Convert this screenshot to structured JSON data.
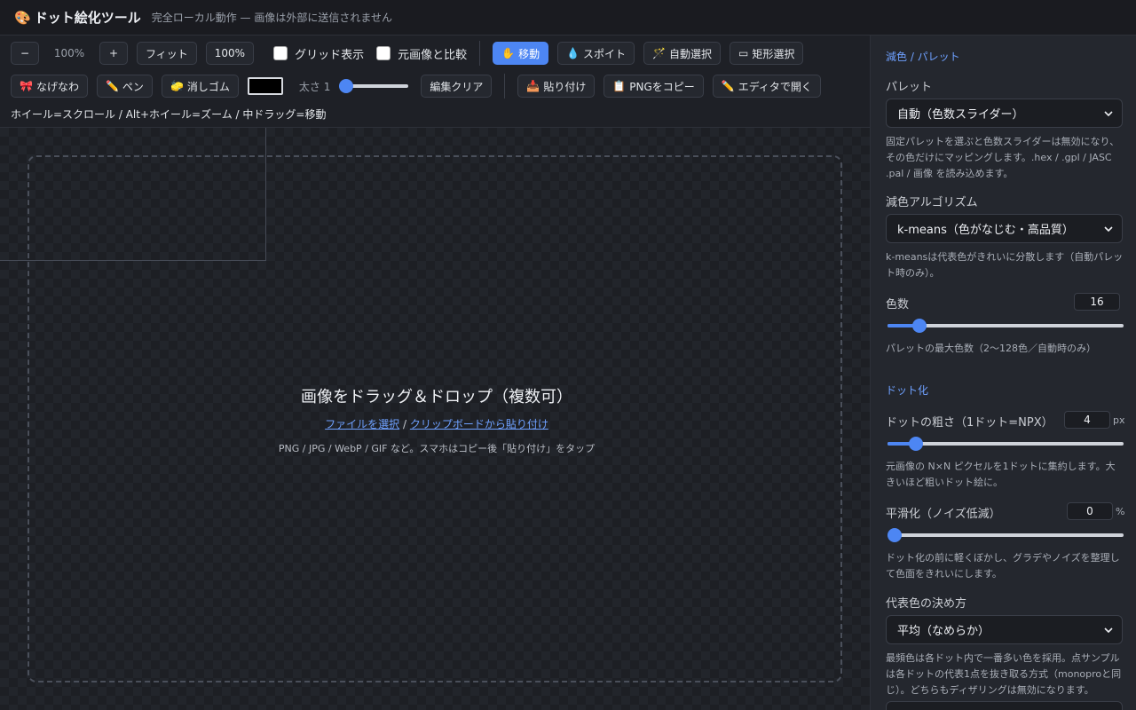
{
  "header": {
    "logo_icon": "palette-icon",
    "logo_glyph": "🎨",
    "title": "ドット絵化ツール",
    "subtitle": "完全ローカル動作 — 画像は外部に送信されません"
  },
  "toolbar": {
    "zoom_out": "−",
    "zoom_level": "100%",
    "zoom_in": "+",
    "fit": "フィット",
    "actual": "100%",
    "grid_label": "グリッド表示",
    "grid_checked": false,
    "compare_label": "元画像と比較",
    "compare_checked": false,
    "move": "移動",
    "move_glyph": "✋",
    "eyedropper": "スポイト",
    "eyedropper_glyph": "💧",
    "auto_select": "自動選択",
    "auto_select_glyph": "🪄",
    "rect_select": "矩形選択",
    "rect_select_glyph": "▭",
    "lasso": "なげなわ",
    "lasso_glyph": "🎀",
    "pen": "ペン",
    "pen_glyph": "✏️",
    "eraser": "消しゴム",
    "eraser_glyph": "🧽",
    "pen_color": "#000000",
    "thickness_label": "太さ 1",
    "thickness_value": 1,
    "thickness_min": 1,
    "thickness_max": 32,
    "clear_edit": "編集クリア",
    "paste": "貼り付け",
    "paste_glyph": "📥",
    "copy_png": "PNGをコピー",
    "copy_png_glyph": "📋",
    "open_editor": "エディタで開く",
    "open_editor_glyph": "✏️",
    "hint": "ホイール=スクロール / Alt+ホイール=ズーム / 中ドラッグ=移動"
  },
  "dropzone": {
    "title": "画像をドラッグ＆ドロップ（複数可）",
    "choose_file": "ファイルを選択",
    "separator": " / ",
    "paste_clipboard": "クリップボードから貼り付け",
    "note": "PNG / JPG / WebP / GIF など。スマホはコピー後「貼り付け」をタップ"
  },
  "panel": {
    "section_color": "減色 / パレット",
    "palette_label": "パレット",
    "palette_value": "自動（色数スライダー）",
    "palette_help": "固定パレットを選ぶと色数スライダーは無効になり、その色だけにマッピングします。.hex / .gpl / JASC .pal / 画像 を読み込めます。",
    "algo_label": "減色アルゴリズム",
    "algo_value": "k-means（色がなじむ・高品質）",
    "algo_help": "k-meansは代表色がきれいに分散します（自動パレット時のみ）。",
    "colors_label": "色数",
    "colors_value": "16",
    "colors_num": 16,
    "colors_min": 2,
    "colors_max": 128,
    "colors_help": "パレットの最大色数（2〜128色／自動時のみ）",
    "section_dot": "ドット化",
    "dot_label": "ドットの粗さ（1ドット=NPX）",
    "dot_value": "4",
    "dot_num": 4,
    "dot_min": 1,
    "dot_max": 32,
    "dot_unit": "px",
    "dot_help": "元画像の N×N ピクセルを1ドットに集約します。大きいほど粗いドット絵に。",
    "smooth_label": "平滑化（ノイズ低減）",
    "smooth_value": "0",
    "smooth_num": 0,
    "smooth_unit": "%",
    "smooth_help": "ドット化の前に軽くぼかし、グラデやノイズを整理して色面をきれいにします。",
    "rep_label": "代表色の決め方",
    "rep_value": "平均（なめらか）",
    "rep_help": "最頻色は各ドット内で一番多い色を採用。点サンプルは各ドットの代表1点を抜き取る方式（monoproと同じ）。どちらもディザリングは無効になります。"
  }
}
